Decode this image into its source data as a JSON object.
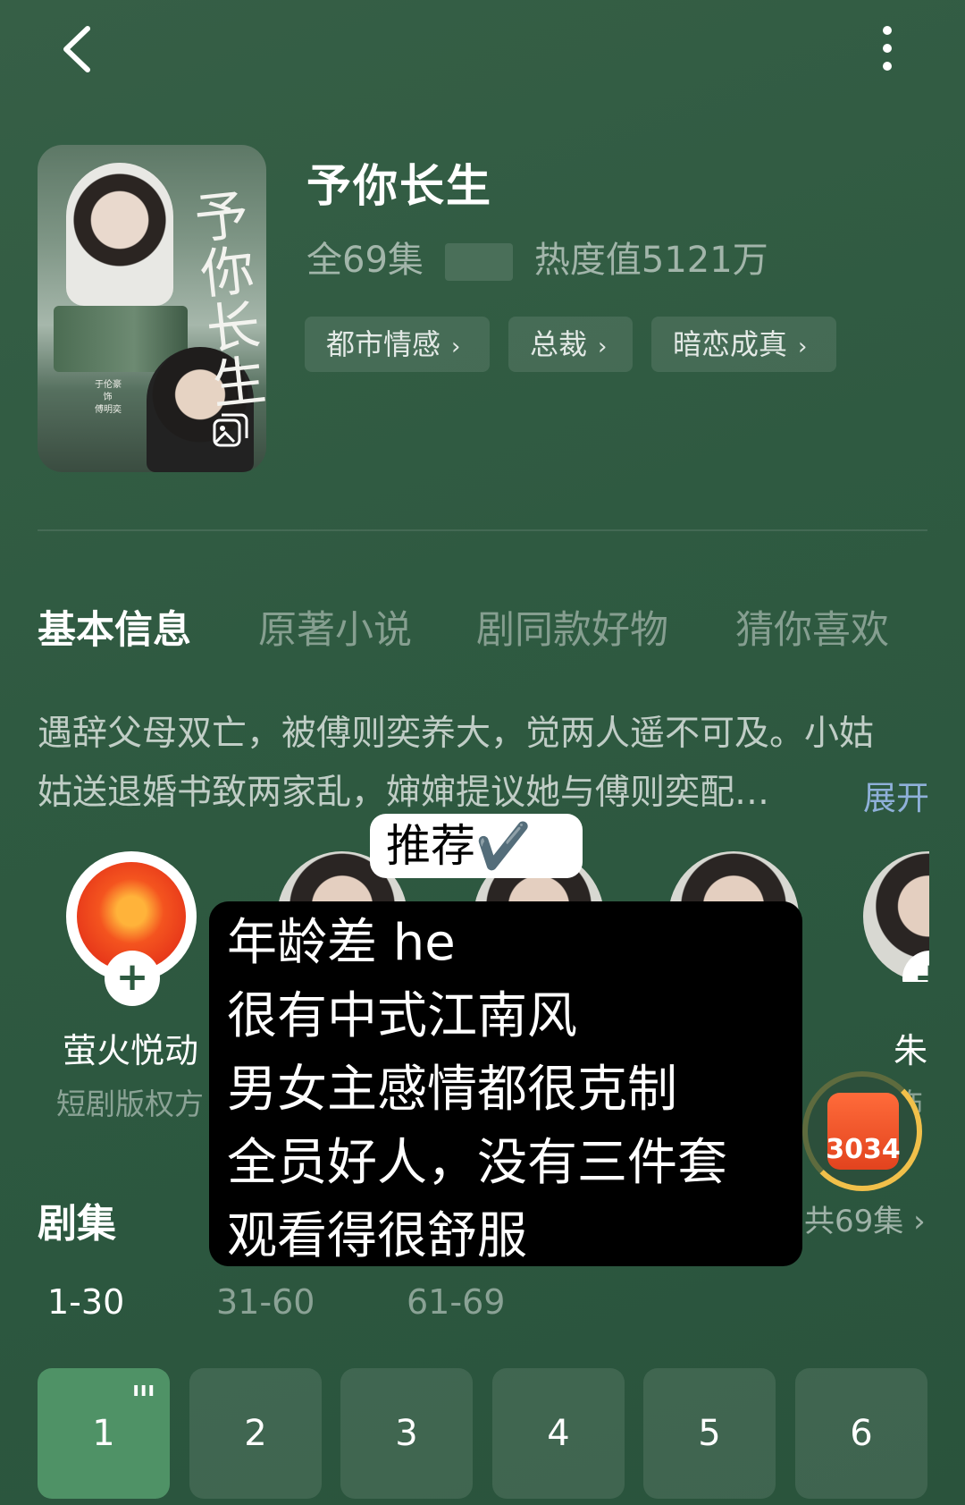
{
  "header": {
    "back_icon": "chevron-left-icon",
    "more_icon": "more-vertical-icon"
  },
  "drama": {
    "title": "予你长生",
    "episodes_total": "全69集",
    "heat": "热度值5121万",
    "poster_title": "予你长生",
    "poster_text": "于伦豪\n   饰\n傅明奕",
    "tags": [
      {
        "label": "都市情感",
        "chevron": "›"
      },
      {
        "label": "总裁",
        "chevron": "›"
      },
      {
        "label": "暗恋成真",
        "chevron": "›"
      }
    ]
  },
  "tabs": [
    {
      "label": "基本信息"
    },
    {
      "label": "原著小说"
    },
    {
      "label": "剧同款好物"
    },
    {
      "label": "猜你喜欢"
    }
  ],
  "description": {
    "text": "遇辞父母双亡，被傅则奕养大，觉两人遥不可及。小姑姑送退婚书致两家乱，婶婶提议她与傅则奕配…",
    "expand": "展开"
  },
  "cast": [
    {
      "name": "萤火悦动",
      "role": "短剧版权方",
      "badge": "+"
    },
    {
      "name": "朱",
      "role": "饰",
      "badge": "+"
    }
  ],
  "overlay": {
    "top_label": "推荐✔️",
    "lines": [
      "年龄差 he",
      "很有中式江南风",
      "男女主感情都很克制",
      "全员好人，没有三件套",
      "观看得很舒服"
    ]
  },
  "reward": {
    "value": "3034"
  },
  "episodes": {
    "section_title": "剧集",
    "all_label": "共69集 ›",
    "ranges": [
      "1-30",
      "31-60",
      "61-69"
    ],
    "items": [
      "1",
      "2",
      "3",
      "4",
      "5",
      "6"
    ],
    "playing_indicator": "ııı"
  },
  "colors": {
    "background": "#2f5a41",
    "active_episode": "#4f9266",
    "expand_link": "#8fb0d9",
    "reward_ring": "#f1c04a"
  }
}
